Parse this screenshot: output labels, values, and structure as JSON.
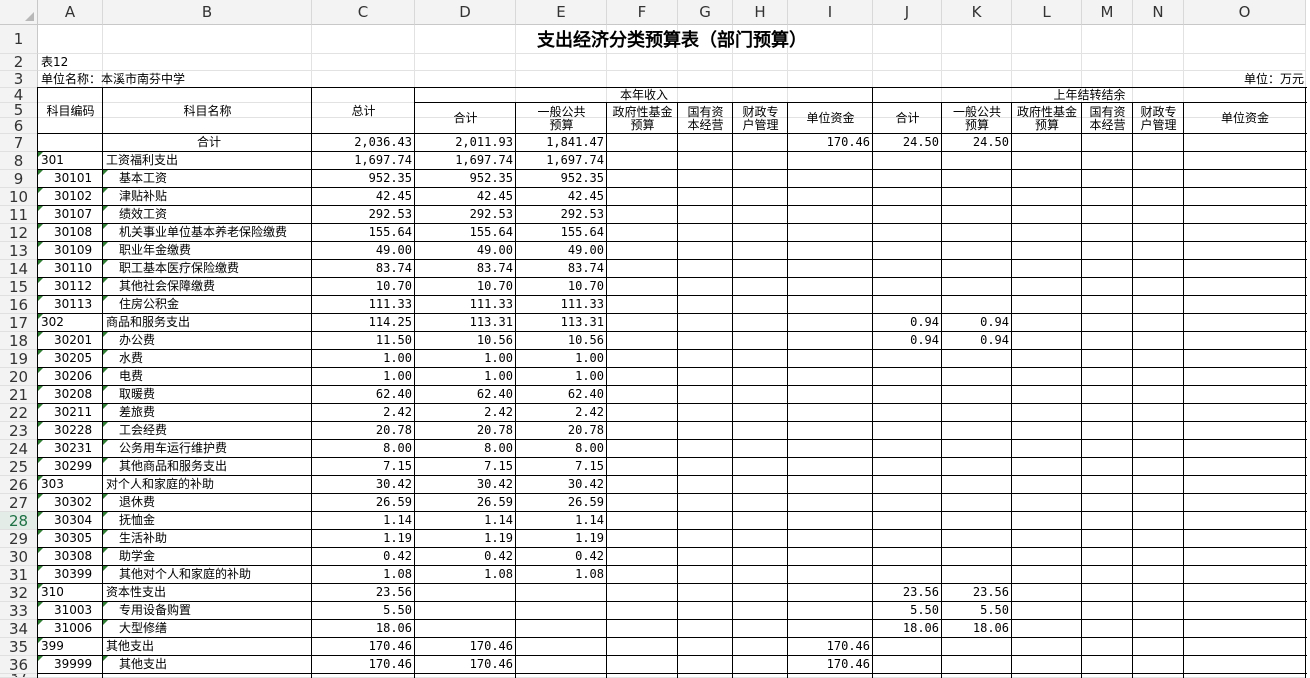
{
  "column_headers": [
    "A",
    "B",
    "C",
    "D",
    "E",
    "F",
    "G",
    "H",
    "I",
    "J",
    "K",
    "L",
    "M",
    "N",
    "O"
  ],
  "selected_row": 28,
  "title": "支出经济分类预算表（部门预算）",
  "table_no": "表12",
  "unit_name": "单位名称：本溪市南芬中学",
  "unit": "单位：万元",
  "headers": {
    "code": "科目编码",
    "name": "科目名称",
    "total": "总计",
    "current_year": "本年收入",
    "carryover": "上年结转结余",
    "sub": [
      "合计",
      "一般公共预算",
      "政府性基金预算",
      "国有资本经营",
      "财政专户管理",
      "单位资金"
    ]
  },
  "total_row": {
    "label": "合计",
    "values": [
      "2,036.43",
      "2,011.93",
      "1,841.47",
      "",
      "",
      "",
      "170.46",
      "24.50",
      "24.50",
      "",
      "",
      "",
      ""
    ]
  },
  "rows": [
    {
      "code": "301",
      "name": "工资福利支出",
      "ind": false,
      "values": [
        "1,697.74",
        "1,697.74",
        "1,697.74",
        "",
        "",
        "",
        "",
        "",
        "",
        "",
        "",
        "",
        ""
      ]
    },
    {
      "code": "30101",
      "name": "基本工资",
      "ind": true,
      "values": [
        "952.35",
        "952.35",
        "952.35",
        "",
        "",
        "",
        "",
        "",
        "",
        "",
        "",
        "",
        ""
      ]
    },
    {
      "code": "30102",
      "name": "津贴补贴",
      "ind": true,
      "values": [
        "42.45",
        "42.45",
        "42.45",
        "",
        "",
        "",
        "",
        "",
        "",
        "",
        "",
        "",
        ""
      ]
    },
    {
      "code": "30107",
      "name": "绩效工资",
      "ind": true,
      "values": [
        "292.53",
        "292.53",
        "292.53",
        "",
        "",
        "",
        "",
        "",
        "",
        "",
        "",
        "",
        ""
      ]
    },
    {
      "code": "30108",
      "name": "机关事业单位基本养老保险缴费",
      "ind": true,
      "values": [
        "155.64",
        "155.64",
        "155.64",
        "",
        "",
        "",
        "",
        "",
        "",
        "",
        "",
        "",
        ""
      ]
    },
    {
      "code": "30109",
      "name": "职业年金缴费",
      "ind": true,
      "values": [
        "49.00",
        "49.00",
        "49.00",
        "",
        "",
        "",
        "",
        "",
        "",
        "",
        "",
        "",
        ""
      ]
    },
    {
      "code": "30110",
      "name": "职工基本医疗保险缴费",
      "ind": true,
      "values": [
        "83.74",
        "83.74",
        "83.74",
        "",
        "",
        "",
        "",
        "",
        "",
        "",
        "",
        "",
        ""
      ]
    },
    {
      "code": "30112",
      "name": "其他社会保障缴费",
      "ind": true,
      "values": [
        "10.70",
        "10.70",
        "10.70",
        "",
        "",
        "",
        "",
        "",
        "",
        "",
        "",
        "",
        ""
      ]
    },
    {
      "code": "30113",
      "name": "住房公积金",
      "ind": true,
      "values": [
        "111.33",
        "111.33",
        "111.33",
        "",
        "",
        "",
        "",
        "",
        "",
        "",
        "",
        "",
        ""
      ]
    },
    {
      "code": "302",
      "name": "商品和服务支出",
      "ind": false,
      "values": [
        "114.25",
        "113.31",
        "113.31",
        "",
        "",
        "",
        "",
        "0.94",
        "0.94",
        "",
        "",
        "",
        ""
      ]
    },
    {
      "code": "30201",
      "name": "办公费",
      "ind": true,
      "values": [
        "11.50",
        "10.56",
        "10.56",
        "",
        "",
        "",
        "",
        "0.94",
        "0.94",
        "",
        "",
        "",
        ""
      ]
    },
    {
      "code": "30205",
      "name": "水费",
      "ind": true,
      "values": [
        "1.00",
        "1.00",
        "1.00",
        "",
        "",
        "",
        "",
        "",
        "",
        "",
        "",
        "",
        ""
      ]
    },
    {
      "code": "30206",
      "name": "电费",
      "ind": true,
      "values": [
        "1.00",
        "1.00",
        "1.00",
        "",
        "",
        "",
        "",
        "",
        "",
        "",
        "",
        "",
        ""
      ]
    },
    {
      "code": "30208",
      "name": "取暖费",
      "ind": true,
      "values": [
        "62.40",
        "62.40",
        "62.40",
        "",
        "",
        "",
        "",
        "",
        "",
        "",
        "",
        "",
        ""
      ]
    },
    {
      "code": "30211",
      "name": "差旅费",
      "ind": true,
      "values": [
        "2.42",
        "2.42",
        "2.42",
        "",
        "",
        "",
        "",
        "",
        "",
        "",
        "",
        "",
        ""
      ]
    },
    {
      "code": "30228",
      "name": "工会经费",
      "ind": true,
      "values": [
        "20.78",
        "20.78",
        "20.78",
        "",
        "",
        "",
        "",
        "",
        "",
        "",
        "",
        "",
        ""
      ]
    },
    {
      "code": "30231",
      "name": "公务用车运行维护费",
      "ind": true,
      "values": [
        "8.00",
        "8.00",
        "8.00",
        "",
        "",
        "",
        "",
        "",
        "",
        "",
        "",
        "",
        ""
      ]
    },
    {
      "code": "30299",
      "name": "其他商品和服务支出",
      "ind": true,
      "values": [
        "7.15",
        "7.15",
        "7.15",
        "",
        "",
        "",
        "",
        "",
        "",
        "",
        "",
        "",
        ""
      ]
    },
    {
      "code": "303",
      "name": "对个人和家庭的补助",
      "ind": false,
      "values": [
        "30.42",
        "30.42",
        "30.42",
        "",
        "",
        "",
        "",
        "",
        "",
        "",
        "",
        "",
        ""
      ]
    },
    {
      "code": "30302",
      "name": "退休费",
      "ind": true,
      "values": [
        "26.59",
        "26.59",
        "26.59",
        "",
        "",
        "",
        "",
        "",
        "",
        "",
        "",
        "",
        ""
      ]
    },
    {
      "code": "30304",
      "name": "抚恤金",
      "ind": true,
      "values": [
        "1.14",
        "1.14",
        "1.14",
        "",
        "",
        "",
        "",
        "",
        "",
        "",
        "",
        "",
        ""
      ]
    },
    {
      "code": "30305",
      "name": "生活补助",
      "ind": true,
      "values": [
        "1.19",
        "1.19",
        "1.19",
        "",
        "",
        "",
        "",
        "",
        "",
        "",
        "",
        "",
        ""
      ]
    },
    {
      "code": "30308",
      "name": "助学金",
      "ind": true,
      "values": [
        "0.42",
        "0.42",
        "0.42",
        "",
        "",
        "",
        "",
        "",
        "",
        "",
        "",
        "",
        ""
      ]
    },
    {
      "code": "30399",
      "name": "其他对个人和家庭的补助",
      "ind": true,
      "values": [
        "1.08",
        "1.08",
        "1.08",
        "",
        "",
        "",
        "",
        "",
        "",
        "",
        "",
        "",
        ""
      ]
    },
    {
      "code": "310",
      "name": "资本性支出",
      "ind": false,
      "values": [
        "23.56",
        "",
        "",
        "",
        "",
        "",
        "",
        "23.56",
        "23.56",
        "",
        "",
        "",
        ""
      ]
    },
    {
      "code": "31003",
      "name": "专用设备购置",
      "ind": true,
      "values": [
        "5.50",
        "",
        "",
        "",
        "",
        "",
        "",
        "5.50",
        "5.50",
        "",
        "",
        "",
        ""
      ]
    },
    {
      "code": "31006",
      "name": "大型修缮",
      "ind": true,
      "values": [
        "18.06",
        "",
        "",
        "",
        "",
        "",
        "",
        "18.06",
        "18.06",
        "",
        "",
        "",
        ""
      ]
    },
    {
      "code": "399",
      "name": "其他支出",
      "ind": false,
      "values": [
        "170.46",
        "170.46",
        "",
        "",
        "",
        "",
        "170.46",
        "",
        "",
        "",
        "",
        "",
        ""
      ]
    },
    {
      "code": "39999",
      "name": "其他支出",
      "ind": true,
      "values": [
        "170.46",
        "170.46",
        "",
        "",
        "",
        "",
        "170.46",
        "",
        "",
        "",
        "",
        "",
        ""
      ]
    }
  ]
}
